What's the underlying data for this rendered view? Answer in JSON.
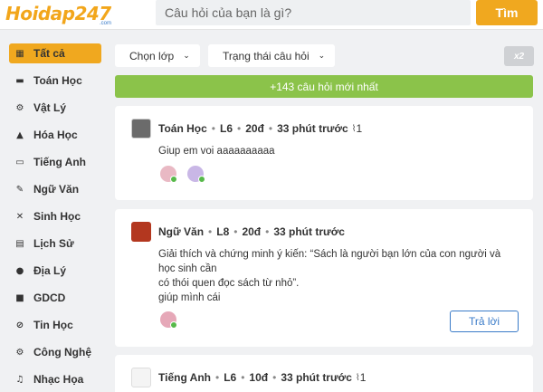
{
  "header": {
    "logo": "Hoidap247",
    "logo_sub": ".com",
    "search_placeholder": "Câu hỏi của bạn là gì?",
    "search_button": "Tìm"
  },
  "sidebar": {
    "items": [
      {
        "label": "Tất cả",
        "icon": "grid-icon",
        "active": true
      },
      {
        "label": "Toán Học",
        "icon": "math-icon"
      },
      {
        "label": "Vật Lý",
        "icon": "physics-icon"
      },
      {
        "label": "Hóa Học",
        "icon": "chemistry-icon"
      },
      {
        "label": "Tiếng Anh",
        "icon": "english-icon"
      },
      {
        "label": "Ngữ Văn",
        "icon": "literature-icon"
      },
      {
        "label": "Sinh Học",
        "icon": "dna-icon"
      },
      {
        "label": "Lịch Sử",
        "icon": "history-icon"
      },
      {
        "label": "Địa Lý",
        "icon": "globe-icon"
      },
      {
        "label": "GDCD",
        "icon": "civics-icon"
      },
      {
        "label": "Tin Học",
        "icon": "computer-icon"
      },
      {
        "label": "Công Nghệ",
        "icon": "technology-icon"
      },
      {
        "label": "Nhạc Họa",
        "icon": "music-icon"
      }
    ]
  },
  "filters": {
    "class_label": "Chọn lớp",
    "status_label": "Trạng thái câu hỏi",
    "x2": "x2"
  },
  "new_questions": "+143 câu hỏi mới nhất",
  "questions": [
    {
      "subject": "Toán Học",
      "grade": "L6",
      "points": "20đ",
      "time": "33 phút trước",
      "attachments": "1",
      "text": [
        "Giup em voi aaaaaaaaaa"
      ]
    },
    {
      "subject": "Ngữ Văn",
      "grade": "L8",
      "points": "20đ",
      "time": "33 phút trước",
      "text": [
        "Giải thích và chứng minh ý kiến: “Sách là người bạn lớn của con người và học sinh cần",
        "có thói quen đọc sách từ nhỏ”.",
        "giúp mình cái"
      ],
      "reply": "Trả lời"
    },
    {
      "subject": "Tiếng Anh",
      "grade": "L6",
      "points": "10đ",
      "time": "33 phút trước",
      "attachments": "1"
    }
  ],
  "colors": {
    "accent": "#f0a81f",
    "green_bar": "#8bc34a",
    "link_blue": "#3a7bc8",
    "background": "#f0f1f3"
  }
}
